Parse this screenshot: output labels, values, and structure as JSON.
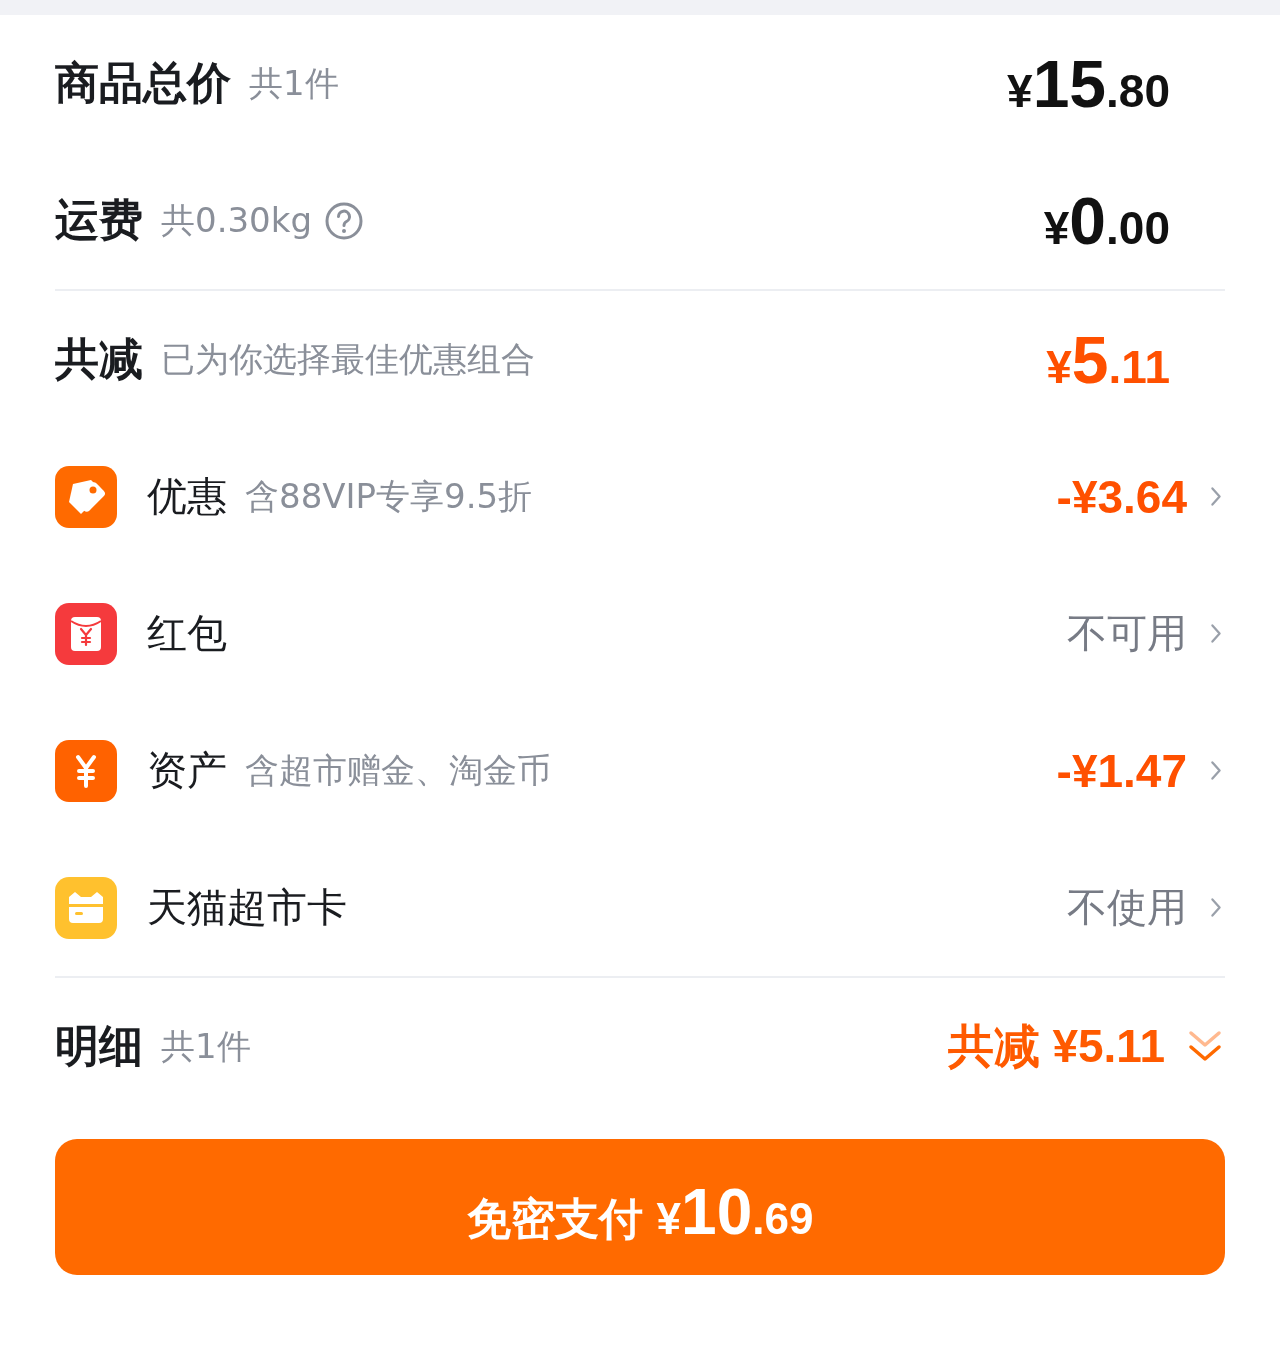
{
  "summary": [
    {
      "title": "商品总价",
      "note": "共1件",
      "help": false,
      "price": {
        "symbol": "¥",
        "integer": "15",
        "decimal": ".80"
      }
    },
    {
      "title": "运费",
      "note": "共0.30kg",
      "help": true,
      "price": {
        "symbol": "¥",
        "integer": "0",
        "decimal": ".00"
      }
    }
  ],
  "total_discount": {
    "title": "共减",
    "note": "已为你选择最佳优惠组合",
    "price": {
      "symbol": "¥",
      "integer": "5",
      "decimal": ".11"
    }
  },
  "benefits": [
    {
      "kind": "amount",
      "color": "#ff6a00",
      "label": "优惠",
      "note": "含88VIP专享9.5折",
      "value": "-¥3.64"
    },
    {
      "kind": "status",
      "color": "#f53a3d",
      "label": "红包",
      "value": "不可用"
    },
    {
      "kind": "amount",
      "color": "#ff6200",
      "label": "资产",
      "note": "含超市赠金、淘金币",
      "value": "-¥1.47"
    },
    {
      "kind": "status",
      "color": "#ffc12e",
      "label": "天猫超市卡",
      "value": "不使用"
    }
  ],
  "details": {
    "title": "明细",
    "note": "共1件",
    "summary": "共减 ¥5.11",
    "expanded": false
  },
  "pay_button": {
    "label": "免密支付",
    "price": {
      "symbol": "¥",
      "integer": "10",
      "decimal": ".69"
    }
  }
}
